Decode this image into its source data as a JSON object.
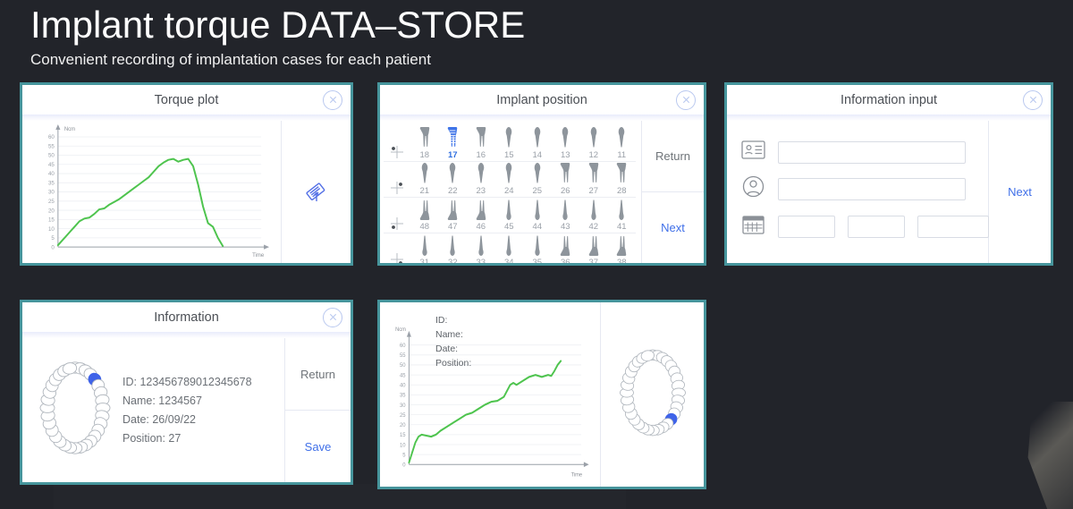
{
  "header": {
    "title": "Implant torque DATA–STORE",
    "subtitle": "Convenient recording of implantation cases for each patient"
  },
  "colors": {
    "background": "#23252b",
    "panel_border": "#46959c",
    "accent_blue": "#3f6fe8",
    "chart_line_green": "#4ec44e",
    "muted_text": "#6f7479",
    "close_icon": "#b9c8ef"
  },
  "panels": {
    "torque_plot": {
      "title": "Torque plot",
      "close_label": "×",
      "close_icon": "circle-x-icon",
      "side_icon": "rotate-save-icon"
    },
    "implant_position": {
      "title": "Implant position",
      "close_label": "×",
      "close_icon": "circle-x-icon",
      "return_label": "Return",
      "next_label": "Next",
      "selected_tooth": "17",
      "rows": [
        {
          "quadrant": "upper-right",
          "teeth": [
            "18",
            "17",
            "16",
            "15",
            "14",
            "13",
            "12",
            "11"
          ]
        },
        {
          "quadrant": "upper-left",
          "teeth": [
            "21",
            "22",
            "23",
            "24",
            "25",
            "26",
            "27",
            "28"
          ]
        },
        {
          "quadrant": "lower-right",
          "teeth": [
            "48",
            "47",
            "46",
            "45",
            "44",
            "43",
            "42",
            "41"
          ]
        },
        {
          "quadrant": "lower-left",
          "teeth": [
            "31",
            "32",
            "33",
            "34",
            "35",
            "36",
            "37",
            "38"
          ]
        }
      ]
    },
    "information_input": {
      "title": "Information input",
      "close_label": "×",
      "close_icon": "circle-x-icon",
      "next_label": "Next",
      "fields": {
        "id": {
          "icon": "id-card-icon",
          "value": "",
          "placeholder": ""
        },
        "name": {
          "icon": "person-icon",
          "value": "",
          "placeholder": ""
        },
        "date": {
          "icon": "calendar-icon",
          "day": {
            "value": "",
            "placeholder": ""
          },
          "month": {
            "value": "",
            "placeholder": ""
          },
          "year": {
            "value": "",
            "placeholder": ""
          }
        }
      }
    },
    "information": {
      "title": "Information",
      "close_label": "×",
      "close_icon": "circle-x-icon",
      "return_label": "Return",
      "save_label": "Save",
      "details": {
        "id": "ID: 123456789012345678",
        "name": "Name: 1234567",
        "date": "Date: 26/09/22",
        "position": "Position: 27"
      },
      "highlighted_tooth_side": "right"
    },
    "record": {
      "labels": {
        "id": "ID:",
        "name": "Name:",
        "date": "Date:",
        "position": "Position:"
      },
      "highlighted_tooth_side": "left"
    }
  },
  "chart_data": [
    {
      "id": "torque_plot",
      "type": "line",
      "title": "Torque plot",
      "xlabel": "Time",
      "ylabel": "Ncm",
      "ylim": [
        0,
        62
      ],
      "yticks": [
        0,
        5,
        10,
        15,
        20,
        25,
        30,
        35,
        40,
        45,
        50,
        55,
        60
      ],
      "grid": true,
      "legend": "none",
      "series": [
        {
          "name": "Torque",
          "color": "#4ec44e",
          "x": [
            0,
            2,
            4,
            6,
            8,
            10,
            13,
            16,
            19,
            22,
            25,
            28,
            31,
            34,
            37,
            40,
            43,
            46,
            49,
            52,
            55,
            58,
            61,
            64,
            67,
            70,
            73,
            76,
            79,
            82,
            85,
            88,
            91,
            94,
            97,
            100
          ],
          "y": [
            1,
            3,
            5,
            7,
            9,
            11,
            14,
            15.5,
            16,
            18,
            20.5,
            21,
            23,
            24.5,
            26,
            28,
            30,
            32,
            34,
            36,
            38,
            41,
            44,
            46,
            47.5,
            48,
            46.5,
            47.5,
            48,
            44,
            34,
            22,
            13,
            11,
            5,
            0.5
          ]
        }
      ]
    },
    {
      "id": "record_plot",
      "type": "line",
      "title": "",
      "xlabel": "Time",
      "ylabel": "Ncm",
      "ylim": [
        0,
        62
      ],
      "yticks": [
        0,
        5,
        10,
        15,
        20,
        25,
        30,
        35,
        40,
        45,
        50,
        55,
        60
      ],
      "grid": true,
      "legend": "none",
      "series": [
        {
          "name": "Torque",
          "color": "#4ec44e",
          "x": [
            0,
            2,
            4,
            6,
            8,
            11,
            14,
            17,
            20,
            24,
            28,
            32,
            36,
            40,
            44,
            48,
            52,
            56,
            60,
            64,
            66,
            68,
            72,
            76,
            80,
            84,
            88,
            90,
            92,
            94,
            96
          ],
          "y": [
            1,
            6,
            11,
            14,
            15,
            14.5,
            14,
            15,
            17,
            19,
            21,
            23,
            25,
            26,
            28,
            30,
            31.5,
            32,
            34,
            40,
            41,
            40,
            42,
            44,
            45,
            44,
            45,
            44.5,
            47,
            50,
            52
          ]
        }
      ]
    }
  ]
}
